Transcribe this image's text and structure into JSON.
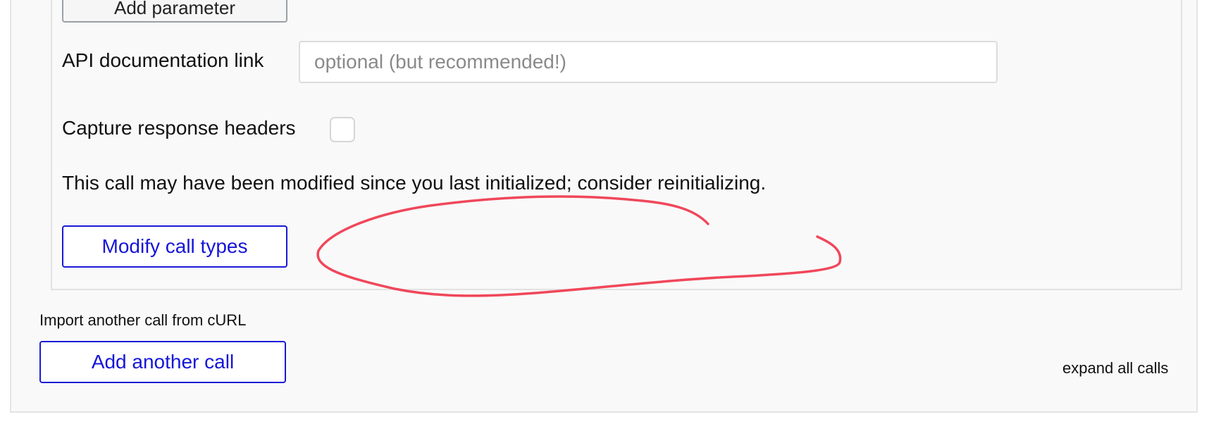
{
  "call_form": {
    "add_parameter_label": "Add parameter",
    "doc_link_label": "API documentation link",
    "doc_link_placeholder": "optional (but recommended!)",
    "doc_link_value": "",
    "capture_headers_label": "Capture response headers",
    "capture_headers_checked": false,
    "warning_text": "This call may have been modified since you last initialized; consider reinitializing.",
    "modify_call_types_label": "Modify call types"
  },
  "footer": {
    "import_curl_label": "Import another call from cURL",
    "add_another_call_label": "Add another call",
    "expand_all_label": "expand all calls"
  },
  "colors": {
    "annotation_stroke": "#f0475a",
    "link_blue": "#1515d8"
  }
}
